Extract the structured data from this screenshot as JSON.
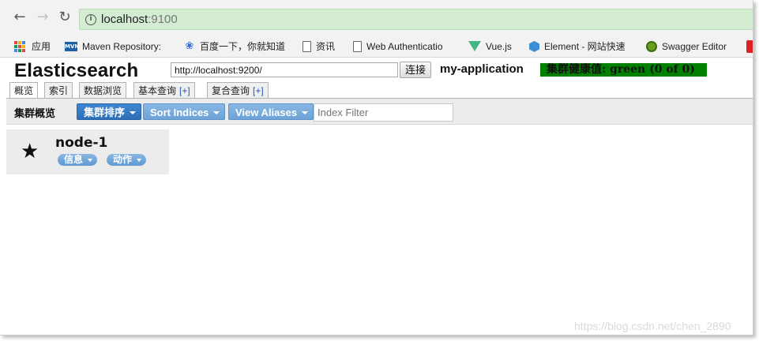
{
  "browser": {
    "url_host": "localhost",
    "url_port": ":9100",
    "bookmarks": [
      {
        "label": "应用",
        "icon": "apps-grid-icon"
      },
      {
        "label": "Maven Repository:",
        "icon": "maven-icon"
      },
      {
        "label": "百度一下，你就知道",
        "icon": "baidu-paw-icon"
      },
      {
        "label": "资讯",
        "icon": "page-icon"
      },
      {
        "label": "Web Authenticatio",
        "icon": "page-icon"
      },
      {
        "label": "Vue.js",
        "icon": "vue-logo-icon"
      },
      {
        "label": "Element - 网站快速",
        "icon": "element-logo-icon"
      },
      {
        "label": "Swagger Editor",
        "icon": "swagger-logo-icon"
      }
    ]
  },
  "app": {
    "title": "Elasticsearch",
    "connection_url": "http://localhost:9200/",
    "connect_label": "连接",
    "cluster_name": "my-application",
    "cluster_health": "集群健康值: green (0 of 0)",
    "health_color": "#008000",
    "tabs": [
      {
        "label": "概览",
        "plus": ""
      },
      {
        "label": "索引",
        "plus": ""
      },
      {
        "label": "数据浏览",
        "plus": ""
      },
      {
        "label": "基本查询",
        "plus": "[+]"
      },
      {
        "label": "复合查询",
        "plus": "[+]"
      }
    ],
    "overview": {
      "title": "集群概览",
      "sort_cluster_label": "集群排序",
      "sort_indices_label": "Sort Indices",
      "view_aliases_label": "View Aliases",
      "index_filter_placeholder": "Index Filter"
    },
    "node": {
      "name": "node-1",
      "info_label": "信息",
      "action_label": "动作"
    }
  },
  "watermark": "https://blog.csdn.net/chen_2890"
}
